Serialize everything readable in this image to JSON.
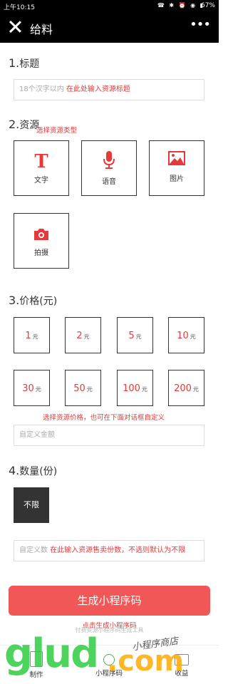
{
  "status": {
    "time": "上午10:15",
    "icons": "☎ ✱ ⏰ ◉ ▮",
    "battery": "67%"
  },
  "nav": {
    "title": "给料",
    "more": "•••"
  },
  "sections": {
    "title": {
      "num": "1.",
      "label": "标题"
    },
    "resource": {
      "num": "2.",
      "label": "资源",
      "hint": "选择资源类型"
    },
    "price": {
      "num": "3.",
      "label": "价格(元)",
      "hint": "选择资源价格，也可在下面对话框自定义"
    },
    "quantity": {
      "num": "4.",
      "label": "数量(份)"
    }
  },
  "title_input": {
    "placeholder": "18个汉字以内",
    "hint": "在此处输入资源标题"
  },
  "resource_types": [
    {
      "label": "文字",
      "icon": "text-icon"
    },
    {
      "label": "语音",
      "icon": "microphone-icon"
    },
    {
      "label": "图片",
      "icon": "image-icon"
    },
    {
      "label": "拍摄",
      "icon": "camera-icon"
    }
  ],
  "prices": [
    {
      "value": "1",
      "unit": "元"
    },
    {
      "value": "2",
      "unit": "元"
    },
    {
      "value": "5",
      "unit": "元"
    },
    {
      "value": "10",
      "unit": "元"
    },
    {
      "value": "30",
      "unit": "元"
    },
    {
      "value": "50",
      "unit": "元"
    },
    {
      "value": "100",
      "unit": "元"
    },
    {
      "value": "200",
      "unit": "元"
    }
  ],
  "custom_price": {
    "placeholder": "自定义金额"
  },
  "quantity": {
    "option": "不限"
  },
  "custom_qty": {
    "placeholder": "自定义数",
    "hint": "在此输入资源售卖份数，不选则默认为不限"
  },
  "generate": {
    "label": "生成小程序码",
    "hint": "点击生成小程序码",
    "footnote": "付费资源小程序码生成工具"
  },
  "tabs": [
    {
      "label": "制作",
      "icon": "edit-icon"
    },
    {
      "label": "小程序码",
      "icon": "qrcode-icon"
    },
    {
      "label": "收益",
      "icon": "wallet-icon"
    }
  ],
  "watermark": {
    "brand": "glud.com",
    "tagline": "小程序商店"
  },
  "colors": {
    "accent": "#e63a3a",
    "button": "#f25757",
    "bar": "#000000"
  }
}
